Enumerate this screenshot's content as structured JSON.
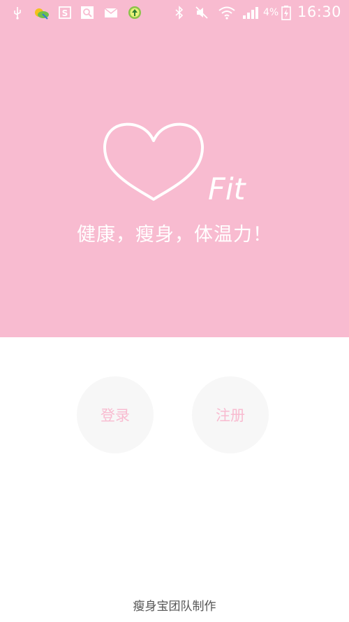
{
  "status_bar": {
    "battery_percent": "4%",
    "time": "16:30",
    "icons": [
      "usb-icon",
      "weather-icon",
      "app-s-icon",
      "search-app-icon",
      "mail-icon",
      "upload-icon",
      "bluetooth-icon",
      "mute-icon",
      "wifi-icon",
      "signal-icon",
      "battery-charging-icon"
    ]
  },
  "logo": {
    "wordmark": "Fit"
  },
  "slogan": "健康，瘦身，体温力！",
  "buttons": {
    "login_label": "登录",
    "register_label": "注册"
  },
  "footer": {
    "credit": "瘦身宝团队制作"
  },
  "colors": {
    "brand_pink": "#f8bbd0",
    "button_bg": "#f7f7f7",
    "footer_text": "#555555"
  }
}
